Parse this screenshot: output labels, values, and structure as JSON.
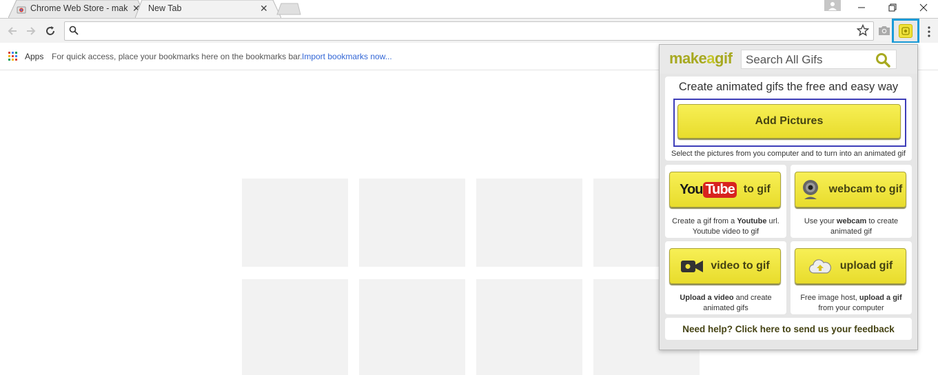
{
  "tabs": [
    {
      "title": "Chrome Web Store - mak",
      "close": "✕"
    },
    {
      "title": "New Tab",
      "close": "✕"
    }
  ],
  "window_controls": {
    "minimize": "—",
    "restore": "❐",
    "close": "✕"
  },
  "omnibox": {
    "value": "",
    "placeholder": ""
  },
  "bookmarks_bar": {
    "apps_label": "Apps",
    "hint": "For quick access, place your bookmarks here on the bookmarks bar.",
    "import_link": "Import bookmarks now..."
  },
  "popup": {
    "logo": {
      "part1": "make",
      "part2": "a",
      "part3": "gif"
    },
    "search": {
      "placeholder": "Search All Gifs"
    },
    "tagline": "Create animated gifs the free and easy way",
    "add_pictures": {
      "label": "Add Pictures",
      "desc": "Select the pictures from you computer and to turn into an animated gif"
    },
    "youtube": {
      "logo_you": "You",
      "logo_tube": "Tube",
      "label": "to gif",
      "desc_1": "Create a gif from a ",
      "desc_bold": "Youtube",
      "desc_2": " url. Youtube video to gif"
    },
    "webcam": {
      "label": "webcam to gif",
      "desc_1": "Use your ",
      "desc_bold": "webcam",
      "desc_2": " to create animated gif"
    },
    "video": {
      "label": "video to gif",
      "desc_bold": "Upload a video",
      "desc_2": " and create animated gifs"
    },
    "upload": {
      "label": "upload gif",
      "desc_1": "Free image host, ",
      "desc_bold": "upload a gif",
      "desc_2": " from your computer"
    },
    "help": "Need help? Click here to send us your feedback"
  },
  "colors": {
    "accent_border": "#1a9bd8",
    "button_yellow": "#f0e23a",
    "logo_olive": "#a7a920",
    "frame_blue": "#3d3db8",
    "link_blue": "#3367d6"
  }
}
